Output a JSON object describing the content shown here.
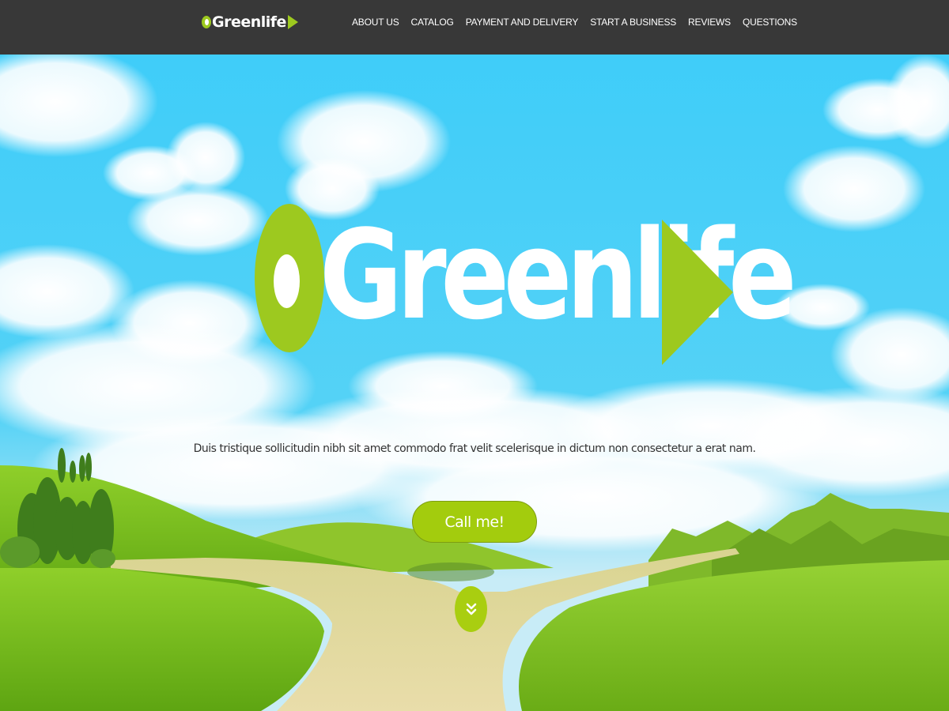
{
  "header": {
    "brand": "Greenlife",
    "nav": [
      {
        "label": "ABOUT US"
      },
      {
        "label": "CATALOG"
      },
      {
        "label": "PAYMENT AND DELIVERY"
      },
      {
        "label": "START A BUSINESS"
      },
      {
        "label": "REVIEWS"
      },
      {
        "label": "QUESTIONS"
      }
    ]
  },
  "hero": {
    "logo_text": "Greenlife",
    "tagline": "Duis tristique sollicitudin nibh sit amet commodo frat velit scelerisque in dictum non consectetur a erat nam.",
    "cta_label": "Call me!",
    "scroll_icon": "double-chevron-down-icon"
  },
  "colors": {
    "header_bg": "#383838",
    "accent_green": "#9dc91f",
    "sky_blue": "#3ecdf8",
    "text_dark": "#333333"
  }
}
